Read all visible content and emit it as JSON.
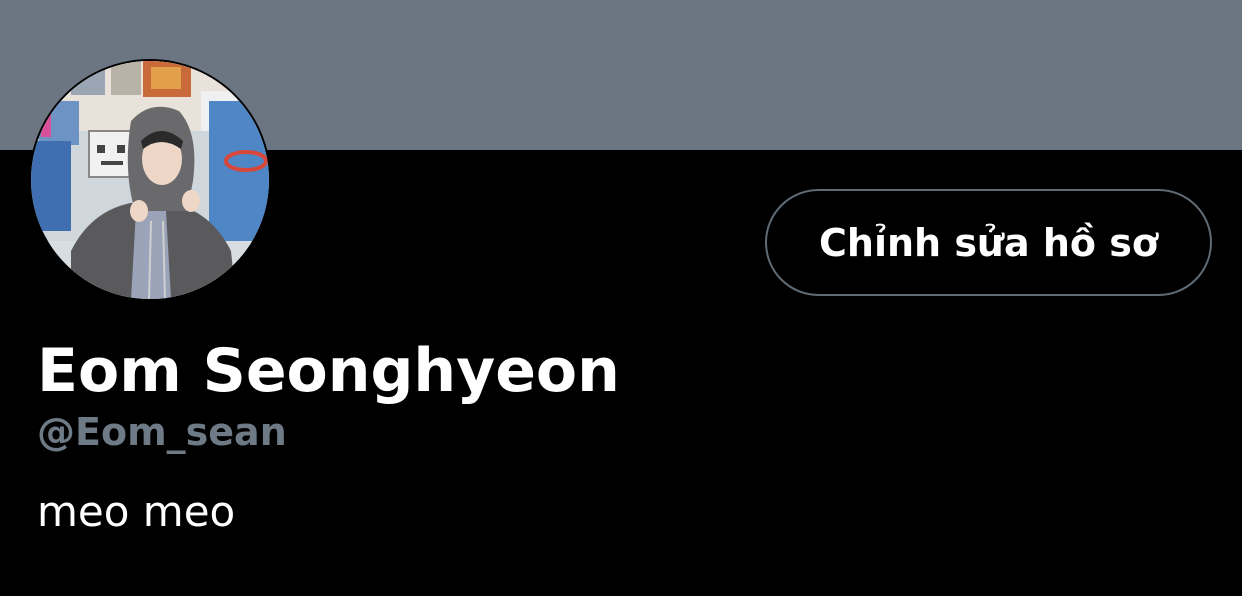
{
  "profile": {
    "display_name": "Eom Seonghyeon",
    "handle": "@Eom_sean",
    "bio": "meo meo",
    "edit_button_label": "Chỉnh sửa hồ sơ",
    "banner_color": "#6b7682",
    "background_color": "#000000",
    "handle_color": "#6e7a85",
    "avatar_icon": "profile-photo"
  }
}
